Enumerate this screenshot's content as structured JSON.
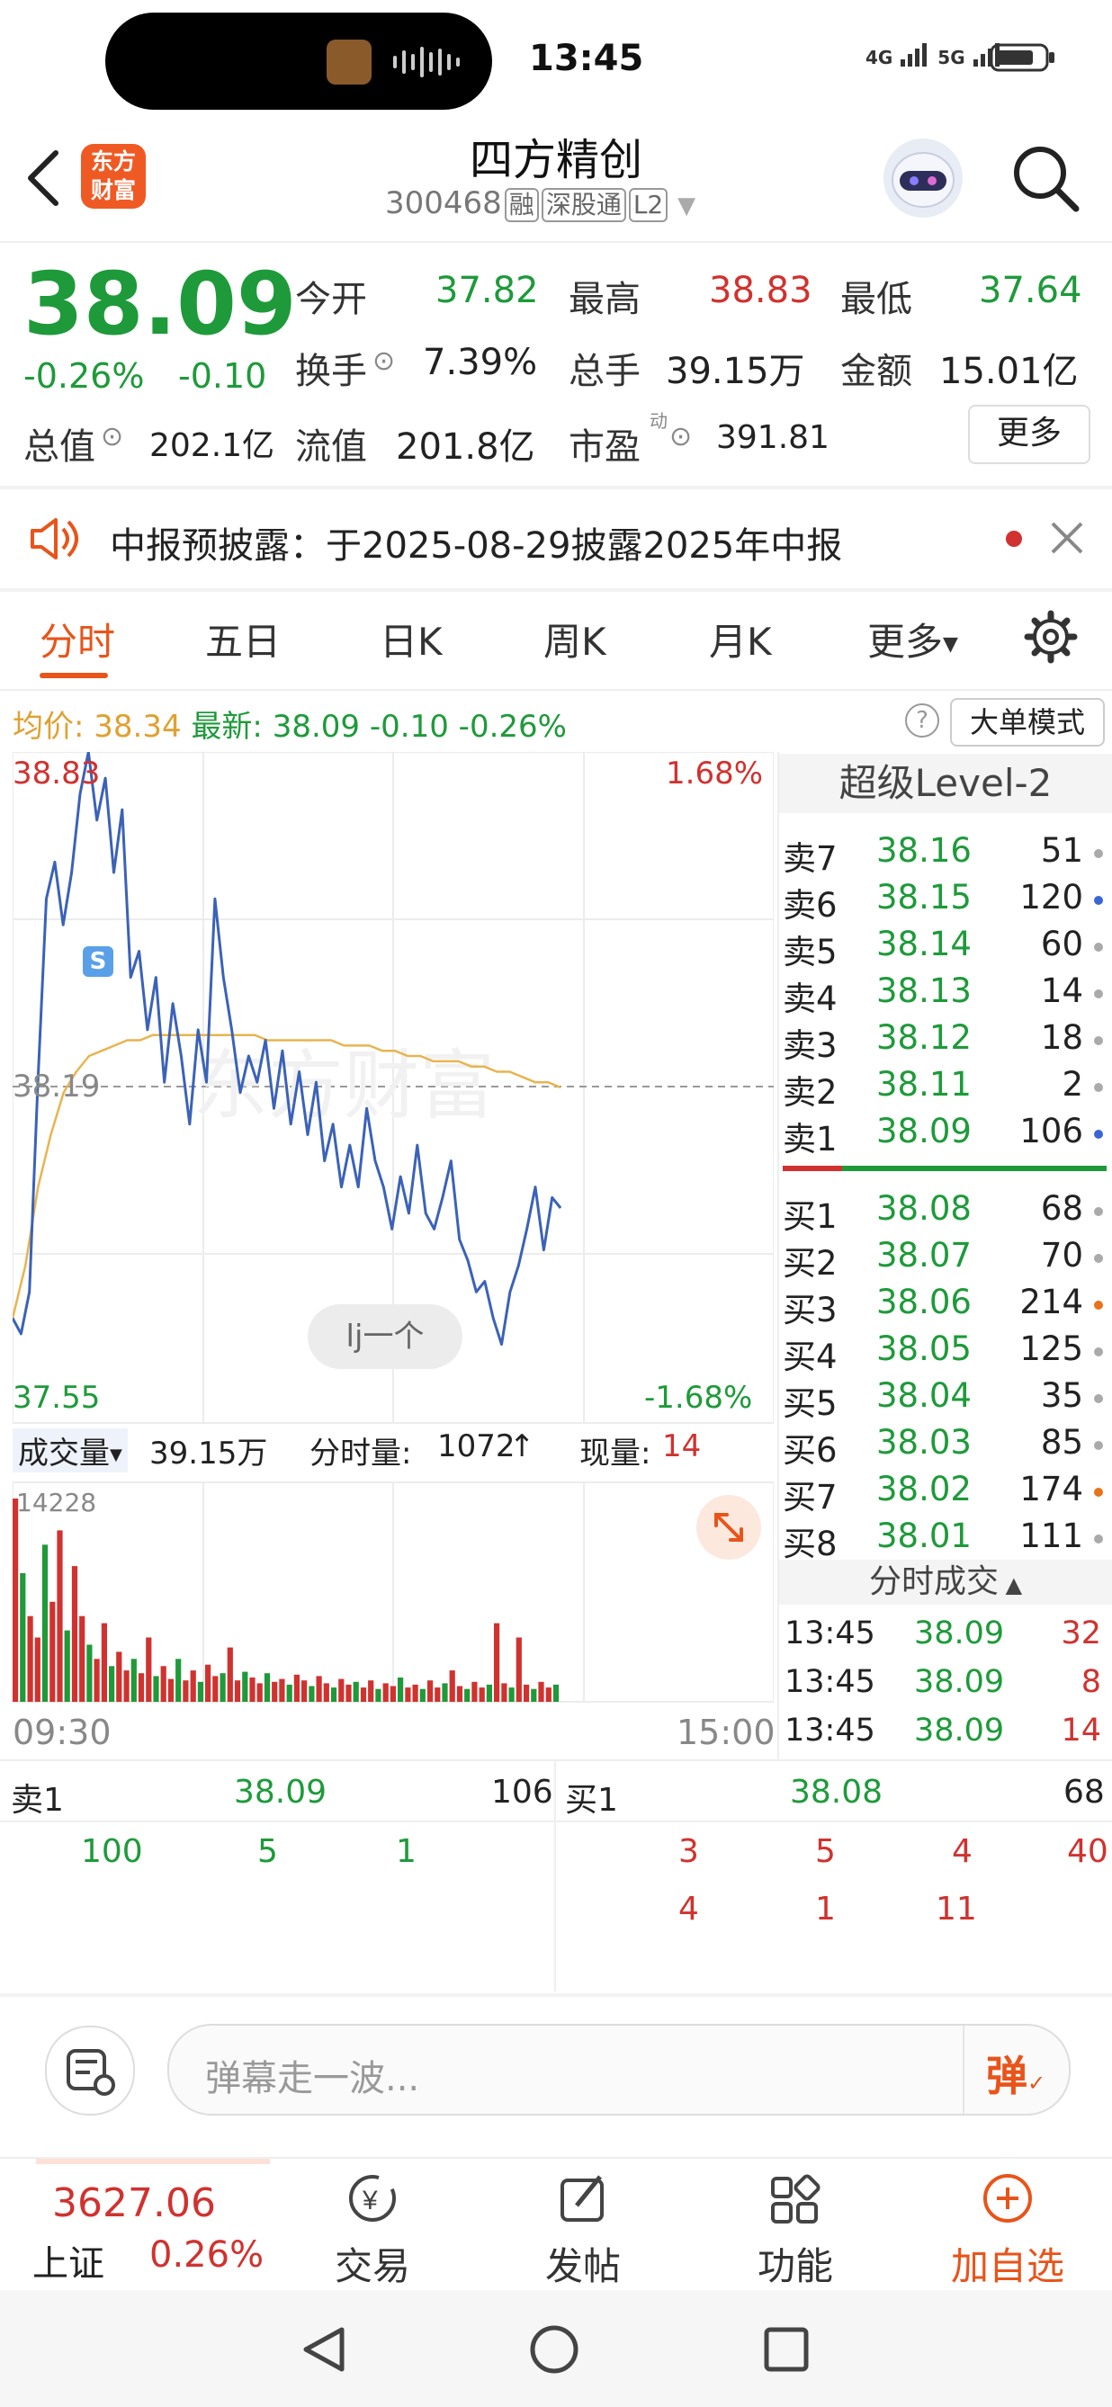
{
  "status_bar": {
    "time": "13:45",
    "signal_4g": "4G",
    "signal_5g": "5G"
  },
  "header": {
    "logo_line1": "东方",
    "logo_line2": "财富",
    "title": "四方精创",
    "code": "300468",
    "tags": [
      "融",
      "深股通",
      "L2"
    ]
  },
  "quote": {
    "price": "38.09",
    "change_pct": "-0.26%",
    "change": "-0.10",
    "open_label": "今开",
    "open": "37.82",
    "high_label": "最高",
    "high": "38.83",
    "low_label": "最低",
    "low": "37.64",
    "turnover_label": "换手",
    "turnover": "7.39%",
    "volume_label": "总手",
    "volume": "39.15万",
    "amount_label": "金额",
    "amount": "15.01亿",
    "mktcap_label": "总值",
    "mktcap": "202.1亿",
    "float_label": "流值",
    "float_cap": "201.8亿",
    "pe_label": "市盈",
    "pe_sup": "动",
    "pe": "391.81",
    "more_label": "更多"
  },
  "notice": {
    "text": "中报预披露：于2025-08-29披露2025年中报"
  },
  "tabs": [
    "分时",
    "五日",
    "日K",
    "周K",
    "月K",
    "更多"
  ],
  "info_bar": {
    "avg_label": "均价:",
    "avg": "38.34",
    "latest_label": "最新:",
    "latest": "38.09",
    "chg": "-0.10",
    "chg_pct": "-0.26%",
    "mode_label": "大单模式"
  },
  "chart": {
    "price_top": "38.83",
    "pct_top": "1.68%",
    "price_mid": "38.19",
    "price_bottom": "37.55",
    "pct_bottom": "-1.68%",
    "watermark": "东方财富",
    "bubble": "lj一个",
    "badge": "S",
    "vol_label": "成交量",
    "vol_total": "39.15万",
    "tick_vol_label": "分时量:",
    "tick_vol": "1072",
    "cur_vol_label": "现量:",
    "cur_vol": "14",
    "vol_max": "14228",
    "time_start": "09:30",
    "time_end": "15:00"
  },
  "chart_data": {
    "type": "line",
    "series": [
      {
        "values": [
          37.75,
          37.72,
          37.8,
          38.2,
          38.55,
          38.62,
          38.5,
          38.6,
          38.75,
          38.83,
          38.7,
          38.78,
          38.6,
          38.72,
          38.4,
          38.45,
          38.3,
          38.4,
          38.2,
          38.35,
          38.25,
          38.12,
          38.3,
          38.2,
          38.55,
          38.4,
          38.3,
          38.18,
          38.25,
          38.2,
          38.28,
          38.15,
          38.26,
          38.12,
          38.22,
          38.1,
          38.2,
          38.05,
          38.12,
          38.0,
          38.08,
          38.0,
          38.15,
          38.05,
          38.0,
          37.92,
          38.02,
          37.95,
          38.08,
          37.95,
          37.92,
          37.98,
          38.05,
          37.9,
          37.86,
          37.8,
          37.82,
          37.75,
          37.7,
          37.8,
          37.85,
          37.92,
          38.0,
          37.88,
          37.98,
          37.96
        ]
      },
      {
        "values": [
          37.75,
          37.85,
          38.0,
          38.1,
          38.18,
          38.22,
          38.25,
          38.26,
          38.27,
          38.28,
          38.28,
          38.29,
          38.29,
          38.29,
          38.29,
          38.29,
          38.29,
          38.29,
          38.29,
          38.29,
          38.28,
          38.28,
          38.28,
          38.28,
          38.28,
          38.28,
          38.27,
          38.27,
          38.27,
          38.26,
          38.26,
          38.25,
          38.25,
          38.24,
          38.24,
          38.24,
          38.23,
          38.23,
          38.22,
          38.22,
          38.21,
          38.2,
          38.2,
          38.19
        ]
      }
    ],
    "ylim": [
      37.55,
      38.83
    ],
    "volume": [
      14228,
      9000,
      6000,
      4500,
      11000,
      7000,
      12000,
      5000,
      9500,
      6000,
      4000,
      3000,
      5500,
      2500,
      3500,
      2200,
      3000,
      2000,
      4500,
      1800,
      2500,
      1600,
      3000,
      1500,
      2200,
      1400,
      2600,
      1800,
      2000,
      3800,
      1500,
      2100,
      1700,
      1300,
      2000,
      1400,
      1600,
      1200,
      1900,
      1500,
      1100,
      1800,
      1300,
      1000,
      1600,
      1200,
      1400,
      1000,
      1500,
      900,
      1300,
      1100,
      1700,
      1000,
      1200,
      900,
      1500,
      1000,
      1300,
      2200,
      1100,
      900,
      1400,
      1000,
      1200,
      5500,
      1300,
      1000,
      4500,
      1200,
      900,
      1400,
      1000,
      1200
    ]
  },
  "ladder": {
    "header": "超级Level-2",
    "asks": [
      {
        "label": "卖7",
        "price": "38.16",
        "qty": "51",
        "dot": "#aaaaaa"
      },
      {
        "label": "卖6",
        "price": "38.15",
        "qty": "120",
        "dot": "#3a66d4"
      },
      {
        "label": "卖5",
        "price": "38.14",
        "qty": "60",
        "dot": "#aaaaaa"
      },
      {
        "label": "卖4",
        "price": "38.13",
        "qty": "14",
        "dot": "#aaaaaa"
      },
      {
        "label": "卖3",
        "price": "38.12",
        "qty": "18",
        "dot": "#aaaaaa"
      },
      {
        "label": "卖2",
        "price": "38.11",
        "qty": "2",
        "dot": "#aaaaaa"
      },
      {
        "label": "卖1",
        "price": "38.09",
        "qty": "106",
        "dot": "#3a66d4"
      }
    ],
    "bids": [
      {
        "label": "买1",
        "price": "38.08",
        "qty": "68",
        "dot": "#aaaaaa"
      },
      {
        "label": "买2",
        "price": "38.07",
        "qty": "70",
        "dot": "#aaaaaa"
      },
      {
        "label": "买3",
        "price": "38.06",
        "qty": "214",
        "dot": "#e8731a"
      },
      {
        "label": "买4",
        "price": "38.05",
        "qty": "125",
        "dot": "#aaaaaa"
      },
      {
        "label": "买5",
        "price": "38.04",
        "qty": "35",
        "dot": "#aaaaaa"
      },
      {
        "label": "买6",
        "price": "38.03",
        "qty": "85",
        "dot": "#aaaaaa"
      },
      {
        "label": "买7",
        "price": "38.02",
        "qty": "174",
        "dot": "#e8731a"
      },
      {
        "label": "买8",
        "price": "38.01",
        "qty": "111",
        "dot": "#aaaaaa"
      }
    ],
    "trades_header": "分时成交",
    "trades": [
      {
        "time": "13:45",
        "price": "38.09",
        "qty": "32"
      },
      {
        "time": "13:45",
        "price": "38.09",
        "qty": "8"
      },
      {
        "time": "13:45",
        "price": "38.09",
        "qty": "14"
      }
    ]
  },
  "queue": {
    "sell_label": "卖1",
    "sell_price": "38.09",
    "sell_qty": "106",
    "buy_label": "买1",
    "buy_price": "38.08",
    "buy_qty": "68",
    "sell_orders": [
      "100",
      "5",
      "1"
    ],
    "buy_orders_row1": [
      "3",
      "5",
      "4",
      "40"
    ],
    "buy_orders_row2": [
      "4",
      "1",
      "11"
    ]
  },
  "danmaku": {
    "placeholder": "弹幕走一波...",
    "send_label": "弹"
  },
  "bottom_bar": {
    "index_value": "3627.06",
    "index_name": "上证",
    "index_pct": "0.26%",
    "items": [
      "交易",
      "发帖",
      "功能",
      "加自选"
    ]
  }
}
